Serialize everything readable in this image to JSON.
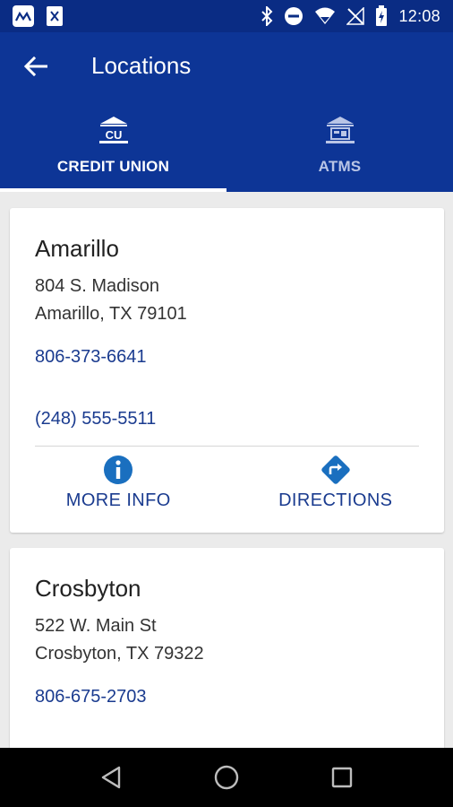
{
  "status_bar": {
    "time": "12:08",
    "notification_icons": [
      "logo-notification-icon",
      "document-notification-icon"
    ],
    "system_icons": [
      "bluetooth-icon",
      "do-not-disturb-icon",
      "wifi-icon",
      "no-signal-icon",
      "battery-charging-icon"
    ]
  },
  "app_bar": {
    "title": "Locations",
    "back_icon": "arrow-back-icon"
  },
  "tabs": [
    {
      "label": "CREDIT UNION",
      "icon": "credit-union-bank-icon",
      "active": true
    },
    {
      "label": "ATMS",
      "icon": "atm-bank-icon",
      "active": false
    }
  ],
  "locations": [
    {
      "name": "Amarillo",
      "address_line1": "804 S. Madison",
      "address_line2": "Amarillo, TX 79101",
      "phone": "806-373-6641",
      "phone_secondary": "(248) 555-5511",
      "actions": {
        "more_info": "MORE INFO",
        "directions": "DIRECTIONS"
      }
    },
    {
      "name": "Crosbyton",
      "address_line1": "522 W. Main St",
      "address_line2": "Crosbyton, TX 79322",
      "phone": "806-675-2703"
    }
  ],
  "colors": {
    "status_bar": "#0a2c84",
    "app_bar": "#0d3596",
    "accent_text": "#1a3b8f",
    "action_icon": "#1a6fbf",
    "background": "#ebebeb"
  },
  "nav_bar": {
    "buttons": [
      "back-triangle-icon",
      "home-circle-icon",
      "recents-square-icon"
    ]
  }
}
